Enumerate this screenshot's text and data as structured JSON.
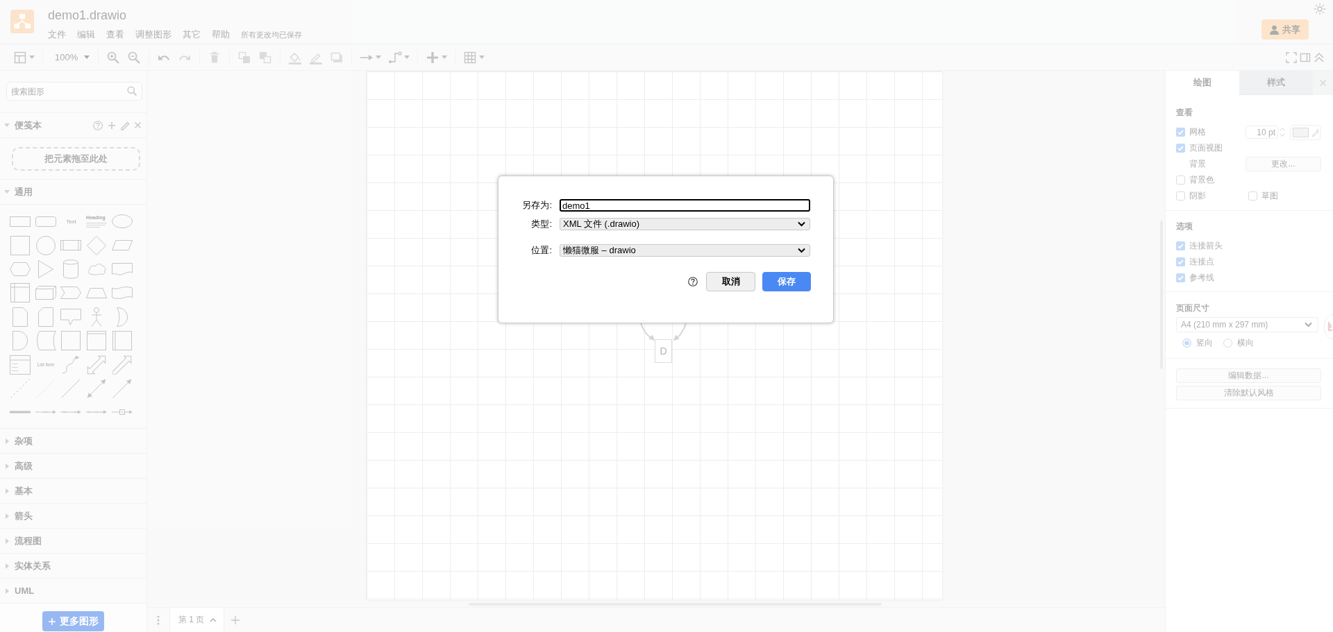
{
  "app": {
    "title": "demo1.drawio",
    "menus": [
      "文件",
      "编辑",
      "查看",
      "调整图形",
      "其它",
      "帮助"
    ],
    "save_status": "所有更改均已保存",
    "share_button": "共享"
  },
  "toolbar": {
    "items": [
      {
        "kind": "format_panel",
        "disabled": false
      },
      {
        "kind": "separator"
      },
      {
        "kind": "zoom",
        "label": "100%",
        "disabled": false
      },
      {
        "kind": "separator"
      },
      {
        "kind": "zoom_in",
        "disabled": false
      },
      {
        "kind": "zoom_out",
        "disabled": false
      },
      {
        "kind": "separator"
      },
      {
        "kind": "undo",
        "disabled": false
      },
      {
        "kind": "redo",
        "disabled": true
      },
      {
        "kind": "separator"
      },
      {
        "kind": "delete",
        "disabled": true
      },
      {
        "kind": "separator"
      },
      {
        "kind": "to_front",
        "disabled": true
      },
      {
        "kind": "to_back",
        "disabled": true
      },
      {
        "kind": "separator"
      },
      {
        "kind": "fill_color",
        "disabled": true
      },
      {
        "kind": "line_color",
        "disabled": true
      },
      {
        "kind": "shadow",
        "disabled": true
      },
      {
        "kind": "separator"
      },
      {
        "kind": "connection",
        "disabled": false
      },
      {
        "kind": "waypoints",
        "disabled": false
      },
      {
        "kind": "separator"
      },
      {
        "kind": "insert",
        "disabled": false
      },
      {
        "kind": "separator"
      },
      {
        "kind": "table",
        "disabled": false
      }
    ],
    "right_items": [
      {
        "kind": "fullscreen"
      },
      {
        "kind": "format_toggle"
      },
      {
        "kind": "collapse"
      }
    ]
  },
  "sidebar": {
    "search": {
      "placeholder": "搜索图形"
    },
    "sections": [
      {
        "title": "便笺本",
        "expanded": true,
        "kind": "scratchpad",
        "drop_hint": "把元素拖至此处"
      },
      {
        "title": "通用",
        "expanded": true,
        "kind": "shapes",
        "shapes": [
          {
            "kind": "rectangle"
          },
          {
            "kind": "rounded_rectangle"
          },
          {
            "kind": "text",
            "label": "Text"
          },
          {
            "kind": "heading",
            "label": "Heading"
          },
          {
            "kind": "ellipse"
          },
          {
            "kind": "square"
          },
          {
            "kind": "circle"
          },
          {
            "kind": "process"
          },
          {
            "kind": "diamond"
          },
          {
            "kind": "parallelogram"
          },
          {
            "kind": "hexagon"
          },
          {
            "kind": "triangle"
          },
          {
            "kind": "cylinder"
          },
          {
            "kind": "cloud"
          },
          {
            "kind": "document"
          },
          {
            "kind": "internal_storage"
          },
          {
            "kind": "cube"
          },
          {
            "kind": "step"
          },
          {
            "kind": "trapezoid"
          },
          {
            "kind": "tape"
          },
          {
            "kind": "note"
          },
          {
            "kind": "card"
          },
          {
            "kind": "callout"
          },
          {
            "kind": "actor"
          },
          {
            "kind": "or"
          },
          {
            "kind": "delay"
          },
          {
            "kind": "data_storage"
          },
          {
            "kind": "container"
          },
          {
            "kind": "swimlane"
          },
          {
            "kind": "column"
          },
          {
            "kind": "list"
          },
          {
            "kind": "list_item",
            "label": "List Item"
          },
          {
            "kind": "curve"
          },
          {
            "kind": "double_arrow"
          },
          {
            "kind": "arrow"
          },
          {
            "kind": "dashed_line"
          },
          {
            "kind": "dotted_line"
          },
          {
            "kind": "line"
          },
          {
            "kind": "bidirectional_line"
          },
          {
            "kind": "directional_line"
          },
          {
            "kind": "link"
          },
          {
            "kind": "connector_label"
          },
          {
            "kind": "connector_2_labels"
          },
          {
            "kind": "connector_3_labels"
          },
          {
            "kind": "connector_symbol"
          }
        ]
      },
      {
        "title": "杂项",
        "expanded": false
      },
      {
        "title": "高级",
        "expanded": false
      },
      {
        "title": "基本",
        "expanded": false
      },
      {
        "title": "箭头",
        "expanded": false
      },
      {
        "title": "流程图",
        "expanded": false
      },
      {
        "title": "实体关系",
        "expanded": false
      },
      {
        "title": "UML",
        "expanded": false
      }
    ],
    "more_button": "更多图形"
  },
  "diagram": {
    "nodes": [
      {
        "label": "D"
      }
    ]
  },
  "bottom_bar": {
    "pages": [
      {
        "label": "第 1 页",
        "selected": true
      }
    ]
  },
  "format_panel": {
    "tabs": [
      {
        "label": "绘图",
        "selected": true
      },
      {
        "label": "样式",
        "selected": false
      }
    ],
    "view": {
      "title": "查看",
      "grid": {
        "label": "网格",
        "checked": true,
        "size": "10 pt"
      },
      "page_view": {
        "label": "页面视图",
        "checked": true
      },
      "background": {
        "label": "背景",
        "button": "更改..."
      },
      "background_color": {
        "label": "背景色",
        "checked": false
      },
      "shadow": {
        "label": "阴影",
        "checked": false
      },
      "sketch": {
        "label": "草图",
        "checked": false
      }
    },
    "options": {
      "title": "选项",
      "items": [
        {
          "label": "连接箭头",
          "checked": true
        },
        {
          "label": "连接点",
          "checked": true
        },
        {
          "label": "参考线",
          "checked": true
        }
      ]
    },
    "paper_size": {
      "title": "页面尺寸",
      "value": "A4 (210 mm x 297 mm)",
      "orientations": [
        {
          "label": "竖向",
          "selected": true
        },
        {
          "label": "横向",
          "selected": false
        }
      ]
    },
    "buttons": [
      "编辑数据...",
      "清除默认风格"
    ]
  },
  "save_dialog": {
    "fields": [
      {
        "kind": "input",
        "label": "另存为:",
        "value": "demo1",
        "focused": true
      },
      {
        "kind": "select",
        "label": "类型:",
        "value": "XML 文件 (.drawio)"
      },
      {
        "kind": "select",
        "label": "位置:",
        "value": "懒猫微服 – drawio"
      }
    ],
    "buttons": [
      {
        "label": "取消",
        "kind": "default"
      },
      {
        "label": "保存",
        "kind": "primary"
      }
    ]
  }
}
